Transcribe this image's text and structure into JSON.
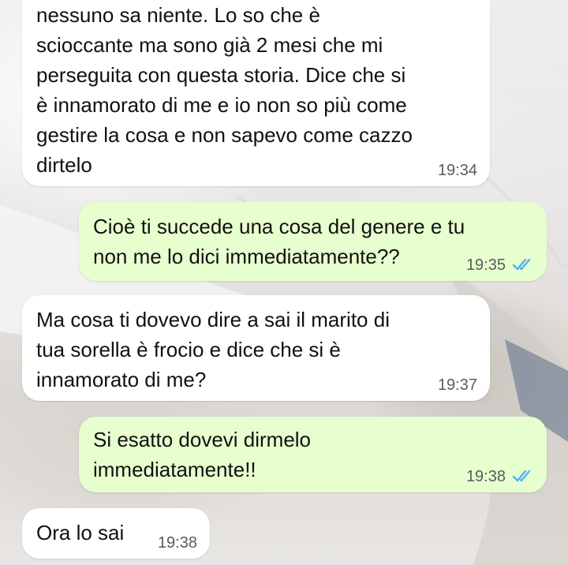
{
  "colors": {
    "incoming_bubble": "#ffffff",
    "outgoing_bubble": "#e7fecf",
    "read_ticks": "#4fb3f6",
    "timestamp": "#5b5b5b"
  },
  "messages": [
    {
      "direction": "incoming",
      "text": "nessuno sa niente. Lo so che è\nscioccante ma sono già 2 mesi che mi\nperseguita con questa storia. Dice che si\nè innamorato di me e io non so più come\ngestire la cosa e non sapevo come cazzo\ndirtelo",
      "time": "19:34"
    },
    {
      "direction": "outgoing",
      "text": "Cioè ti succede una cosa del genere e tu\nnon me lo dici immediatamente??",
      "time": "19:35",
      "status_icon": "double-check-read-icon"
    },
    {
      "direction": "incoming",
      "text": "Ma cosa ti dovevo dire a sai il marito di\ntua sorella è frocio e dice che si è\ninnamorato di me?",
      "time": "19:37"
    },
    {
      "direction": "outgoing",
      "text": "Si esatto dovevi dirmelo\nimmediatamente!!",
      "time": "19:38",
      "status_icon": "double-check-read-icon"
    },
    {
      "direction": "incoming",
      "text": "Ora lo sai",
      "time": "19:38"
    }
  ]
}
